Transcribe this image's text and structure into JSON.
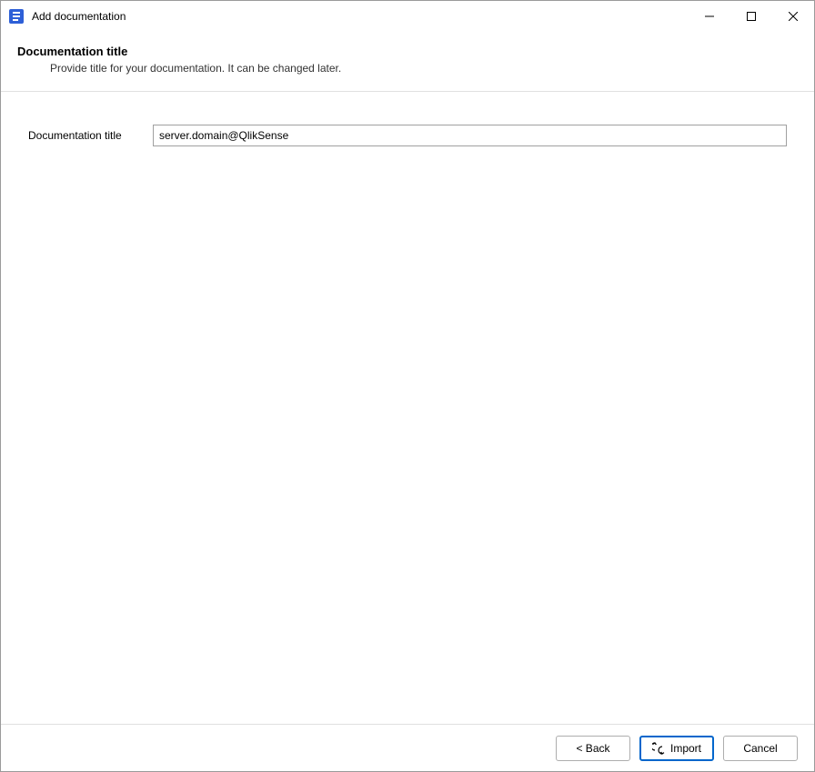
{
  "titlebar": {
    "title": "Add documentation"
  },
  "header": {
    "title": "Documentation title",
    "subtitle": "Provide title for your documentation. It can be changed later."
  },
  "form": {
    "title_label": "Documentation title",
    "title_value": "server.domain@QlikSense"
  },
  "footer": {
    "back_label": "< Back",
    "import_label": "Import",
    "cancel_label": "Cancel"
  }
}
